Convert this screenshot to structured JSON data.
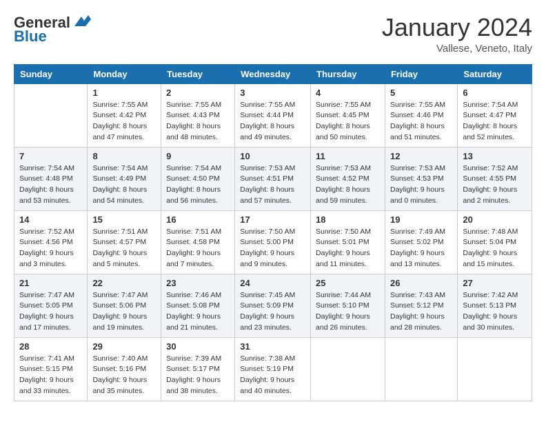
{
  "header": {
    "logo_general": "General",
    "logo_blue": "Blue",
    "month": "January 2024",
    "location": "Vallese, Veneto, Italy"
  },
  "columns": [
    "Sunday",
    "Monday",
    "Tuesday",
    "Wednesday",
    "Thursday",
    "Friday",
    "Saturday"
  ],
  "weeks": [
    [
      {
        "day": "",
        "info": ""
      },
      {
        "day": "1",
        "info": "Sunrise: 7:55 AM\nSunset: 4:42 PM\nDaylight: 8 hours\nand 47 minutes."
      },
      {
        "day": "2",
        "info": "Sunrise: 7:55 AM\nSunset: 4:43 PM\nDaylight: 8 hours\nand 48 minutes."
      },
      {
        "day": "3",
        "info": "Sunrise: 7:55 AM\nSunset: 4:44 PM\nDaylight: 8 hours\nand 49 minutes."
      },
      {
        "day": "4",
        "info": "Sunrise: 7:55 AM\nSunset: 4:45 PM\nDaylight: 8 hours\nand 50 minutes."
      },
      {
        "day": "5",
        "info": "Sunrise: 7:55 AM\nSunset: 4:46 PM\nDaylight: 8 hours\nand 51 minutes."
      },
      {
        "day": "6",
        "info": "Sunrise: 7:54 AM\nSunset: 4:47 PM\nDaylight: 8 hours\nand 52 minutes."
      }
    ],
    [
      {
        "day": "7",
        "info": "Sunrise: 7:54 AM\nSunset: 4:48 PM\nDaylight: 8 hours\nand 53 minutes."
      },
      {
        "day": "8",
        "info": "Sunrise: 7:54 AM\nSunset: 4:49 PM\nDaylight: 8 hours\nand 54 minutes."
      },
      {
        "day": "9",
        "info": "Sunrise: 7:54 AM\nSunset: 4:50 PM\nDaylight: 8 hours\nand 56 minutes."
      },
      {
        "day": "10",
        "info": "Sunrise: 7:53 AM\nSunset: 4:51 PM\nDaylight: 8 hours\nand 57 minutes."
      },
      {
        "day": "11",
        "info": "Sunrise: 7:53 AM\nSunset: 4:52 PM\nDaylight: 8 hours\nand 59 minutes."
      },
      {
        "day": "12",
        "info": "Sunrise: 7:53 AM\nSunset: 4:53 PM\nDaylight: 9 hours\nand 0 minutes."
      },
      {
        "day": "13",
        "info": "Sunrise: 7:52 AM\nSunset: 4:55 PM\nDaylight: 9 hours\nand 2 minutes."
      }
    ],
    [
      {
        "day": "14",
        "info": "Sunrise: 7:52 AM\nSunset: 4:56 PM\nDaylight: 9 hours\nand 3 minutes."
      },
      {
        "day": "15",
        "info": "Sunrise: 7:51 AM\nSunset: 4:57 PM\nDaylight: 9 hours\nand 5 minutes."
      },
      {
        "day": "16",
        "info": "Sunrise: 7:51 AM\nSunset: 4:58 PM\nDaylight: 9 hours\nand 7 minutes."
      },
      {
        "day": "17",
        "info": "Sunrise: 7:50 AM\nSunset: 5:00 PM\nDaylight: 9 hours\nand 9 minutes."
      },
      {
        "day": "18",
        "info": "Sunrise: 7:50 AM\nSunset: 5:01 PM\nDaylight: 9 hours\nand 11 minutes."
      },
      {
        "day": "19",
        "info": "Sunrise: 7:49 AM\nSunset: 5:02 PM\nDaylight: 9 hours\nand 13 minutes."
      },
      {
        "day": "20",
        "info": "Sunrise: 7:48 AM\nSunset: 5:04 PM\nDaylight: 9 hours\nand 15 minutes."
      }
    ],
    [
      {
        "day": "21",
        "info": "Sunrise: 7:47 AM\nSunset: 5:05 PM\nDaylight: 9 hours\nand 17 minutes."
      },
      {
        "day": "22",
        "info": "Sunrise: 7:47 AM\nSunset: 5:06 PM\nDaylight: 9 hours\nand 19 minutes."
      },
      {
        "day": "23",
        "info": "Sunrise: 7:46 AM\nSunset: 5:08 PM\nDaylight: 9 hours\nand 21 minutes."
      },
      {
        "day": "24",
        "info": "Sunrise: 7:45 AM\nSunset: 5:09 PM\nDaylight: 9 hours\nand 23 minutes."
      },
      {
        "day": "25",
        "info": "Sunrise: 7:44 AM\nSunset: 5:10 PM\nDaylight: 9 hours\nand 26 minutes."
      },
      {
        "day": "26",
        "info": "Sunrise: 7:43 AM\nSunset: 5:12 PM\nDaylight: 9 hours\nand 28 minutes."
      },
      {
        "day": "27",
        "info": "Sunrise: 7:42 AM\nSunset: 5:13 PM\nDaylight: 9 hours\nand 30 minutes."
      }
    ],
    [
      {
        "day": "28",
        "info": "Sunrise: 7:41 AM\nSunset: 5:15 PM\nDaylight: 9 hours\nand 33 minutes."
      },
      {
        "day": "29",
        "info": "Sunrise: 7:40 AM\nSunset: 5:16 PM\nDaylight: 9 hours\nand 35 minutes."
      },
      {
        "day": "30",
        "info": "Sunrise: 7:39 AM\nSunset: 5:17 PM\nDaylight: 9 hours\nand 38 minutes."
      },
      {
        "day": "31",
        "info": "Sunrise: 7:38 AM\nSunset: 5:19 PM\nDaylight: 9 hours\nand 40 minutes."
      },
      {
        "day": "",
        "info": ""
      },
      {
        "day": "",
        "info": ""
      },
      {
        "day": "",
        "info": ""
      }
    ]
  ]
}
